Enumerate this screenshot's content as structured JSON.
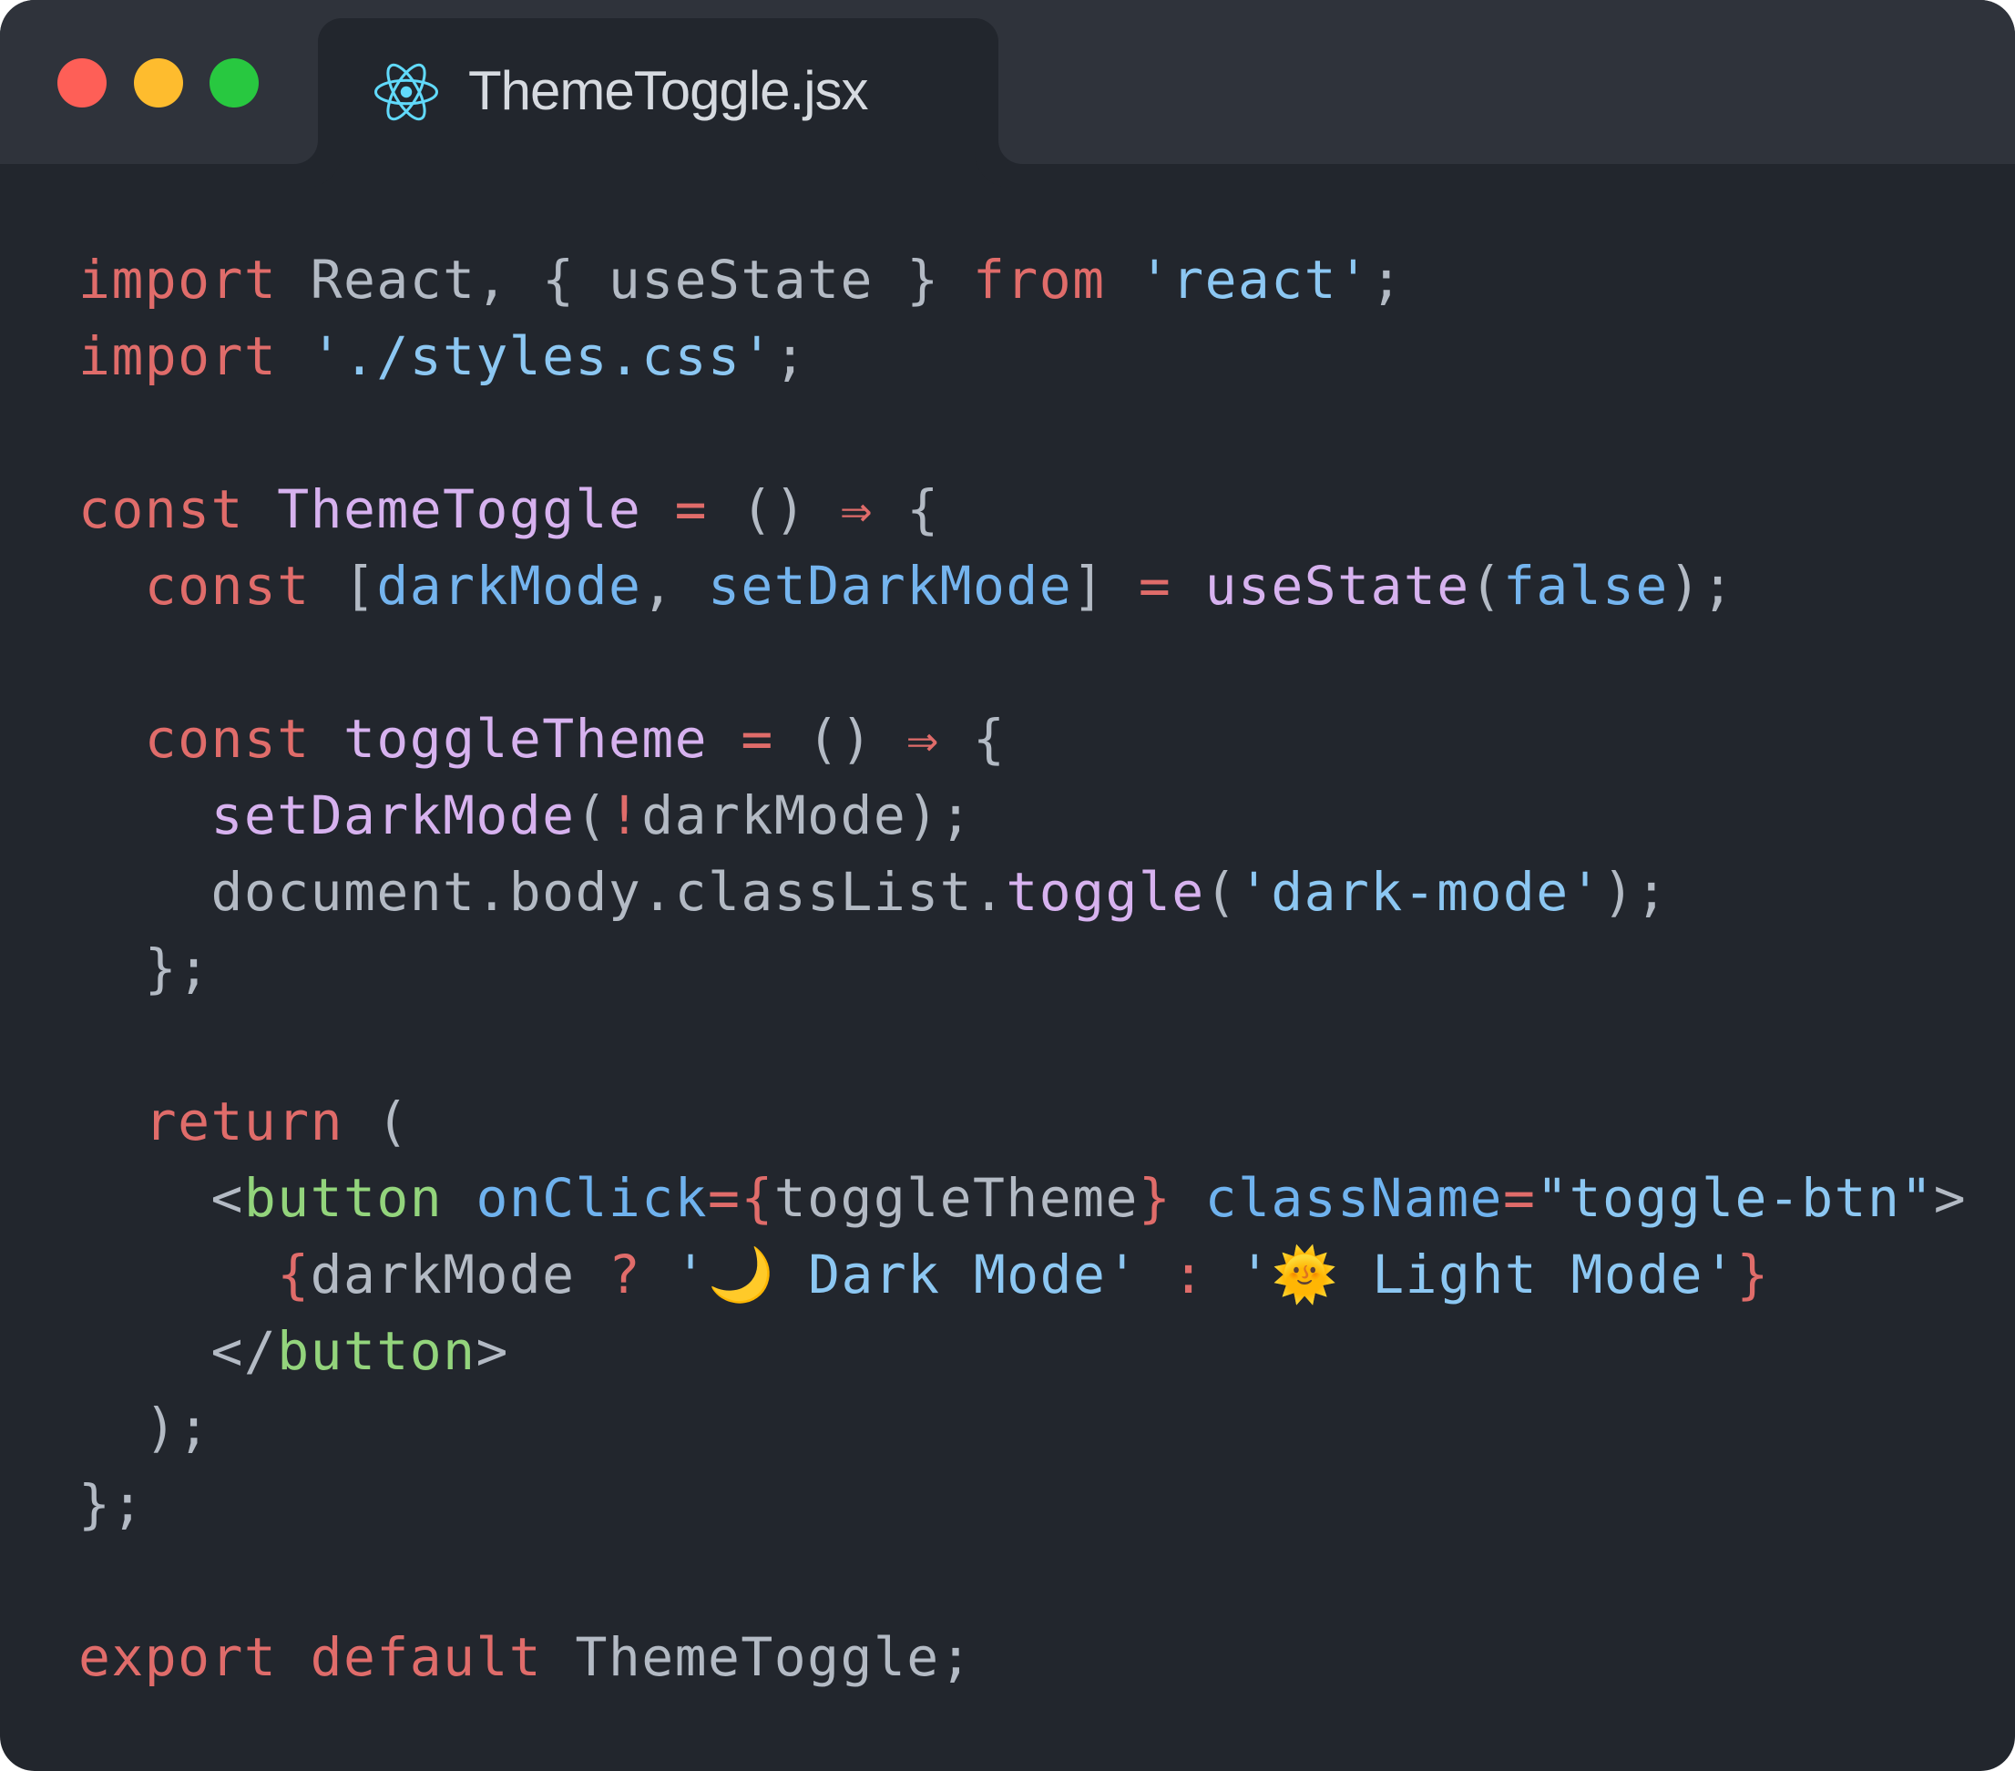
{
  "window": {
    "traffic_lights": [
      {
        "name": "close",
        "color": "#fe5f57"
      },
      {
        "name": "minimize",
        "color": "#febc2e"
      },
      {
        "name": "maximize",
        "color": "#28c840"
      }
    ]
  },
  "tab": {
    "icon": "react-icon",
    "icon_color": "#61dafb",
    "title": "ThemeToggle.jsx"
  },
  "code": {
    "lines": [
      [
        [
          "kw",
          "import"
        ],
        [
          "plain",
          " React, { useState } "
        ],
        [
          "kw",
          "from"
        ],
        [
          "plain",
          " "
        ],
        [
          "str",
          "'react'"
        ],
        [
          "plain",
          ";"
        ]
      ],
      [
        [
          "kw",
          "import"
        ],
        [
          "plain",
          " "
        ],
        [
          "str",
          "'./styles.css'"
        ],
        [
          "plain",
          ";"
        ]
      ],
      [],
      [
        [
          "kw",
          "const"
        ],
        [
          "plain",
          " "
        ],
        [
          "fn",
          "ThemeToggle"
        ],
        [
          "plain",
          " "
        ],
        [
          "op",
          "="
        ],
        [
          "plain",
          " () "
        ],
        [
          "op",
          "⇒"
        ],
        [
          "plain",
          " {"
        ]
      ],
      [
        [
          "plain",
          "  "
        ],
        [
          "kw",
          "const"
        ],
        [
          "plain",
          " ["
        ],
        [
          "var",
          "darkMode"
        ],
        [
          "plain",
          ", "
        ],
        [
          "var",
          "setDarkMode"
        ],
        [
          "plain",
          "] "
        ],
        [
          "op",
          "="
        ],
        [
          "plain",
          " "
        ],
        [
          "fn",
          "useState"
        ],
        [
          "plain",
          "("
        ],
        [
          "var",
          "false"
        ],
        [
          "plain",
          ");"
        ]
      ],
      [],
      [
        [
          "plain",
          "  "
        ],
        [
          "kw",
          "const"
        ],
        [
          "plain",
          " "
        ],
        [
          "fn",
          "toggleTheme"
        ],
        [
          "plain",
          " "
        ],
        [
          "op",
          "="
        ],
        [
          "plain",
          " () "
        ],
        [
          "op",
          "⇒"
        ],
        [
          "plain",
          " {"
        ]
      ],
      [
        [
          "plain",
          "    "
        ],
        [
          "fn",
          "setDarkMode"
        ],
        [
          "plain",
          "("
        ],
        [
          "op",
          "!"
        ],
        [
          "plain",
          "darkMode);"
        ]
      ],
      [
        [
          "plain",
          "    document.body.classList."
        ],
        [
          "fn",
          "toggle"
        ],
        [
          "plain",
          "("
        ],
        [
          "str",
          "'dark-mode'"
        ],
        [
          "plain",
          ");"
        ]
      ],
      [
        [
          "plain",
          "  };"
        ]
      ],
      [],
      [
        [
          "plain",
          "  "
        ],
        [
          "kw",
          "return"
        ],
        [
          "plain",
          " ("
        ]
      ],
      [
        [
          "plain",
          "    <"
        ],
        [
          "tag",
          "button"
        ],
        [
          "plain",
          " "
        ],
        [
          "attr",
          "onClick"
        ],
        [
          "op",
          "="
        ],
        [
          "brace",
          "{"
        ],
        [
          "plain",
          "toggleTheme"
        ],
        [
          "brace",
          "}"
        ],
        [
          "plain",
          " "
        ],
        [
          "attr",
          "className"
        ],
        [
          "op",
          "="
        ],
        [
          "str",
          "\"toggle-btn\""
        ],
        [
          "plain",
          ">"
        ]
      ],
      [
        [
          "plain",
          "      "
        ],
        [
          "brace",
          "{"
        ],
        [
          "plain",
          "darkMode "
        ],
        [
          "op",
          "?"
        ],
        [
          "plain",
          " "
        ],
        [
          "str",
          "'🌙 Dark Mode'"
        ],
        [
          "plain",
          " "
        ],
        [
          "op",
          ":"
        ],
        [
          "plain",
          " "
        ],
        [
          "str",
          "'🌞 Light Mode'"
        ],
        [
          "brace",
          "}"
        ]
      ],
      [
        [
          "plain",
          "    </"
        ],
        [
          "tag",
          "button"
        ],
        [
          "plain",
          ">"
        ]
      ],
      [
        [
          "plain",
          "  );"
        ]
      ],
      [
        [
          "plain",
          "};"
        ]
      ],
      [],
      [
        [
          "kw",
          "export"
        ],
        [
          "plain",
          " "
        ],
        [
          "kw",
          "default"
        ],
        [
          "plain",
          " ThemeToggle;"
        ]
      ]
    ]
  }
}
